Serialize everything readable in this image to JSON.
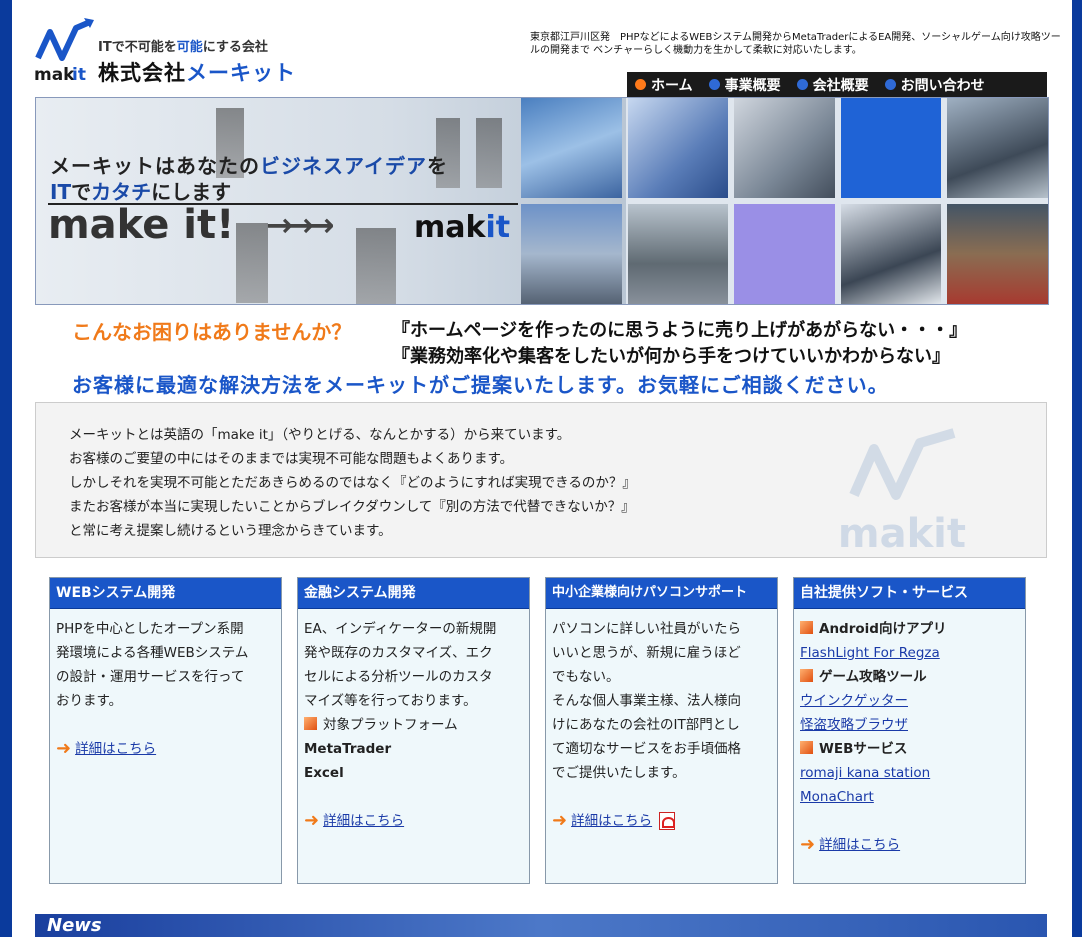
{
  "header": {
    "tagline_parts": [
      "ITで不可能を",
      "可能",
      "にする会社"
    ],
    "company_parts": [
      "株式会社",
      "メーキット"
    ],
    "logo_text": "makit",
    "intro": "東京都江戸川区発　PHPなどによるWEBシステム開発からMetaTraderによるEA開発、ソーシャルゲーム向け攻略ツールの開発まで ベンチャーらしく機動力を生かして柔軟に対応いたします。"
  },
  "nav": [
    {
      "label": "ホーム",
      "color": "#ff7a1a"
    },
    {
      "label": "事業概要",
      "color": "#2f6ad6"
    },
    {
      "label": "会社概要",
      "color": "#2f6ad6"
    },
    {
      "label": "お問い合わせ",
      "color": "#2f6ad6"
    }
  ],
  "banner": {
    "line1_parts": [
      "メーキットはあなたの",
      "ビジネスアイデア",
      "を"
    ],
    "line2_parts": [
      "IT",
      "で",
      "カタチ",
      "にします"
    ],
    "make": "make it!",
    "arrows": "→→→",
    "logo_parts": [
      "mak",
      "it"
    ]
  },
  "troubles": {
    "question": "こんなお困りはありませんか？",
    "quote1": "『ホームページを作ったのに思うように売り上げがあがらない・・・』",
    "quote2": "『業務効率化や集客をしたいが何から手をつけていいかわからない』",
    "solution": "お客様に最適な解決方法をメーキットがご提案いたします。お気軽にご相談ください。"
  },
  "about": {
    "lines": [
      "メーキットとは英語の「make it」（やりとげる、なんとかする）から来ています。",
      "お客様のご要望の中にはそのままでは実現不可能な問題もよくあります。",
      "しかしそれを実現不可能とただあきらめるのではなく『どのようにすれば実現できるのか？』",
      "またお客様が本当に実現したいことからブレイクダウンして『別の方法で代替できないか？』",
      "と常に考え提案し続けるという理念からきています。"
    ],
    "watermark": "makit"
  },
  "boxes": {
    "web": {
      "title": "WEBシステム開発",
      "lines": [
        "PHPを中心としたオープン系開",
        "発環境による各種WEBシステム",
        "の設計・運用サービスを行って",
        "おります。"
      ],
      "more": "詳細はこちら"
    },
    "finance": {
      "title": "金融システム開発",
      "lines": [
        "EA、インディケーターの新規開",
        "発や既存のカスタマイズ、エク",
        "セルによる分析ツールのカスタ",
        "マイズ等を行っております。"
      ],
      "platform_label": "対象プラットフォーム",
      "platforms": [
        "MetaTrader",
        "Excel"
      ],
      "more": "詳細はこちら"
    },
    "support": {
      "title": "中小企業様向けパソコンサポート",
      "lines": [
        "パソコンに詳しい社員がいたら",
        "いいと思うが、新規に雇うほど",
        "でもない。",
        "そんな個人事業主様、法人様向",
        "けにあなたの会社のIT部門とし",
        "て適切なサービスをお手頃価格",
        "でご提供いたします。"
      ],
      "more": "詳細はこちら"
    },
    "own": {
      "title": "自社提供ソフト・サービス",
      "cat1": "Android向けアプリ",
      "cat1_links": [
        "FlashLight For Regza"
      ],
      "cat2": "ゲーム攻略ツール",
      "cat2_links": [
        "ウインクゲッター",
        "怪盗攻略ブラウザ"
      ],
      "cat3": "WEBサービス",
      "cat3_links": [
        "romaji kana station",
        "MonaChart"
      ],
      "more": "詳細はこちら"
    }
  },
  "news": {
    "title": "News"
  }
}
